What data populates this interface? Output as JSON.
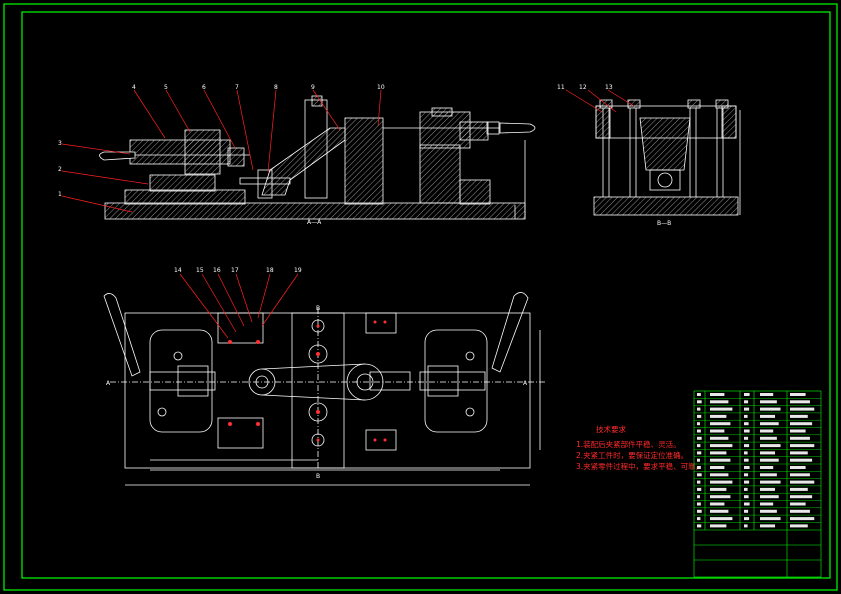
{
  "views": {
    "section_a": {
      "caption": "A—A",
      "callouts": [
        "1",
        "2",
        "3",
        "4",
        "5",
        "6",
        "7",
        "8",
        "9",
        "10"
      ]
    },
    "section_b": {
      "caption": "B—B",
      "callouts": [
        "11",
        "12",
        "13"
      ]
    },
    "plan": {
      "callouts": [
        "14",
        "15",
        "16",
        "17",
        "18",
        "19"
      ],
      "section_marks": [
        "A",
        "A",
        "B",
        "B"
      ]
    }
  },
  "notes": {
    "title": "技术要求",
    "lines": [
      "1.装配后夹紧部件平稳、灵活。",
      "2.夹紧工件时，要保证定位准确。",
      "3.夹紧零件过程中，要求平稳、可靠。"
    ]
  },
  "colors": {
    "frame": "#00ff00",
    "lines": "#ffffff",
    "leaders": "#ff2020",
    "hatch": "#ffffff",
    "table": "#00ff00",
    "table_text": "#ffffff"
  }
}
